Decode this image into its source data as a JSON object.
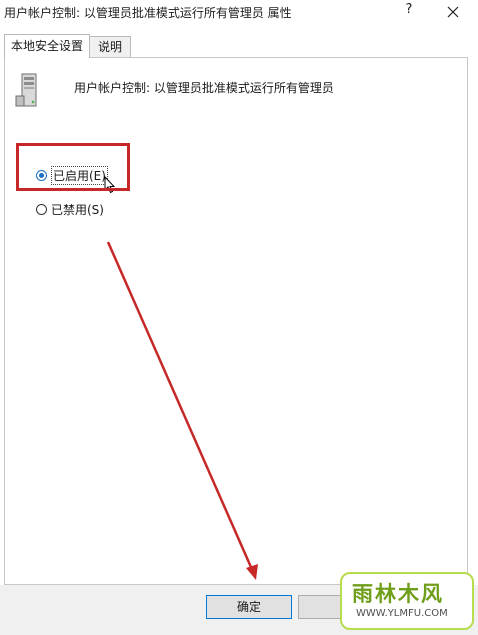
{
  "window": {
    "title": "用户帐户控制: 以管理员批准模式运行所有管理员 属性",
    "help_label": "?"
  },
  "tabs": [
    {
      "label": "本地安全设置",
      "active": true
    },
    {
      "label": "说明",
      "active": false
    }
  ],
  "policy": {
    "icon": "server-policy-icon",
    "name": "用户帐户控制: 以管理员批准模式运行所有管理员"
  },
  "options": {
    "enabled": {
      "label": "已启用(E)",
      "checked": true
    },
    "disabled": {
      "label": "已禁用(S)",
      "checked": false
    }
  },
  "buttons": {
    "ok": "确定",
    "cancel": ""
  },
  "annotation": {
    "color": "#c62828"
  },
  "watermark": {
    "main_text": "雨林木风",
    "url_text": "WWW.YLMFU.COM"
  }
}
